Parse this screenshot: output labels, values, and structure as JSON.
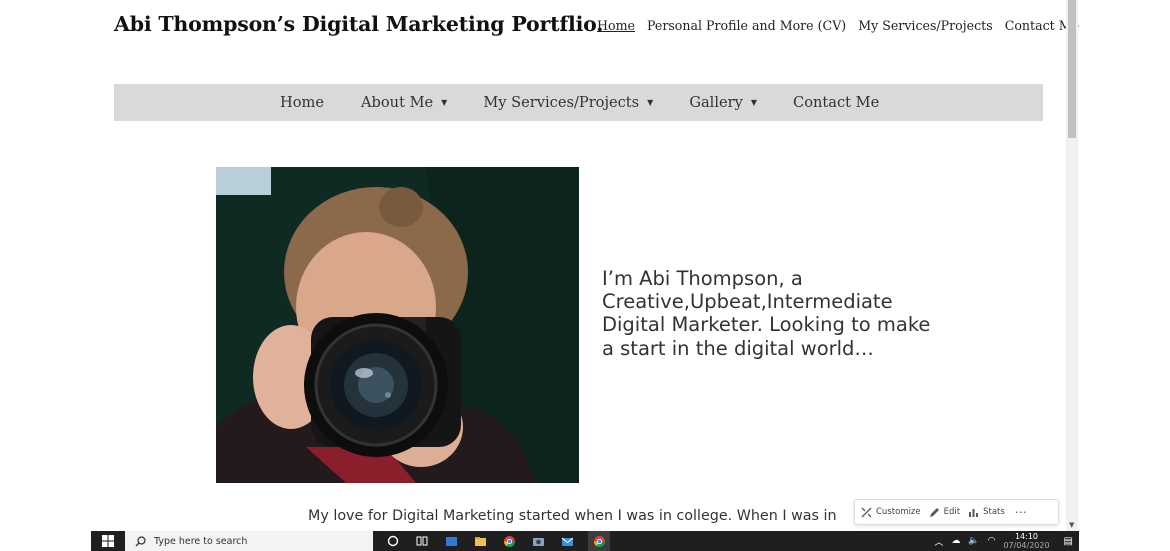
{
  "site": {
    "title": "Abi Thompson’s Digital Marketing Portflio."
  },
  "top_nav": {
    "items": [
      "Home",
      "Personal Profile and More (CV)",
      "My Services/Projects",
      "Contact Me"
    ],
    "active": "Home"
  },
  "main_menu": {
    "items": [
      {
        "label": "Home"
      },
      {
        "label": "About Me"
      },
      {
        "label": "My Services/Projects"
      },
      {
        "label": "Gallery"
      },
      {
        "label": "Contact Me"
      }
    ],
    "bar_color": "#d9d9d9"
  },
  "hero": {
    "intro_text": "I’m Abi Thompson, a Creative,Upbeat,Intermediate Digital Marketer. Looking to make a start in the digital world…",
    "photo_icon": "photographer-image"
  },
  "body": {
    "paragraph_start": "My love for Digital Marketing started when I was in college. When I was in"
  },
  "admin_bar": {
    "customize": "Customize",
    "edit": "Edit",
    "stats": "Stats",
    "more": "⋯"
  },
  "taskbar": {
    "search_placeholder": "Type here to search",
    "time": "14:10",
    "date": "07/04/2020"
  },
  "colors": {
    "taskbar": "#1f1f1f",
    "title": "#111111",
    "photo_bg": "#0f2a22"
  }
}
